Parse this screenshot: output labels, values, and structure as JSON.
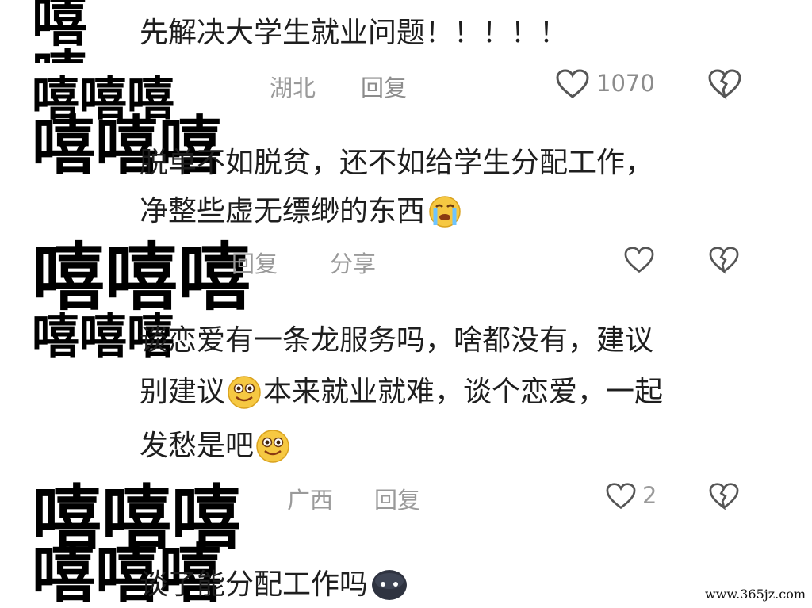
{
  "comments": [
    {
      "lines": [
        "先解决大学生就业问题！！！！！"
      ],
      "location": "湖北",
      "reply_label": "回复",
      "like_count": "1070"
    },
    {
      "lines": [
        "脱单不如脱贫，还不如给学生分配工作，",
        "净整些虚无缥缈的东西"
      ],
      "reply_label": "回复",
      "share_label": "分享"
    },
    {
      "lines": [
        "谈恋爱有一条龙服务吗，啥都没有，建议",
        "别建议",
        "本来就业就难，谈个恋爱，一起",
        "发愁是吧"
      ],
      "location": "广西",
      "reply_label": "回复",
      "like_count": "2"
    },
    {
      "lines": [
        "谈了能分配工作吗"
      ]
    }
  ],
  "mosaic_text": "嘻嘻嘻",
  "watermark": "www.365jz.com",
  "icons": {
    "like": "heart-outline-icon",
    "dislike": "broken-heart-icon",
    "emoji_crying": "crying-face-emoji",
    "emoji_smile": "smiling-face-emoji",
    "emoji_dark": "dark-face-emoji"
  },
  "colors": {
    "text": "#1e1e1e",
    "meta": "#9a9a9a",
    "icon": "#555555"
  }
}
